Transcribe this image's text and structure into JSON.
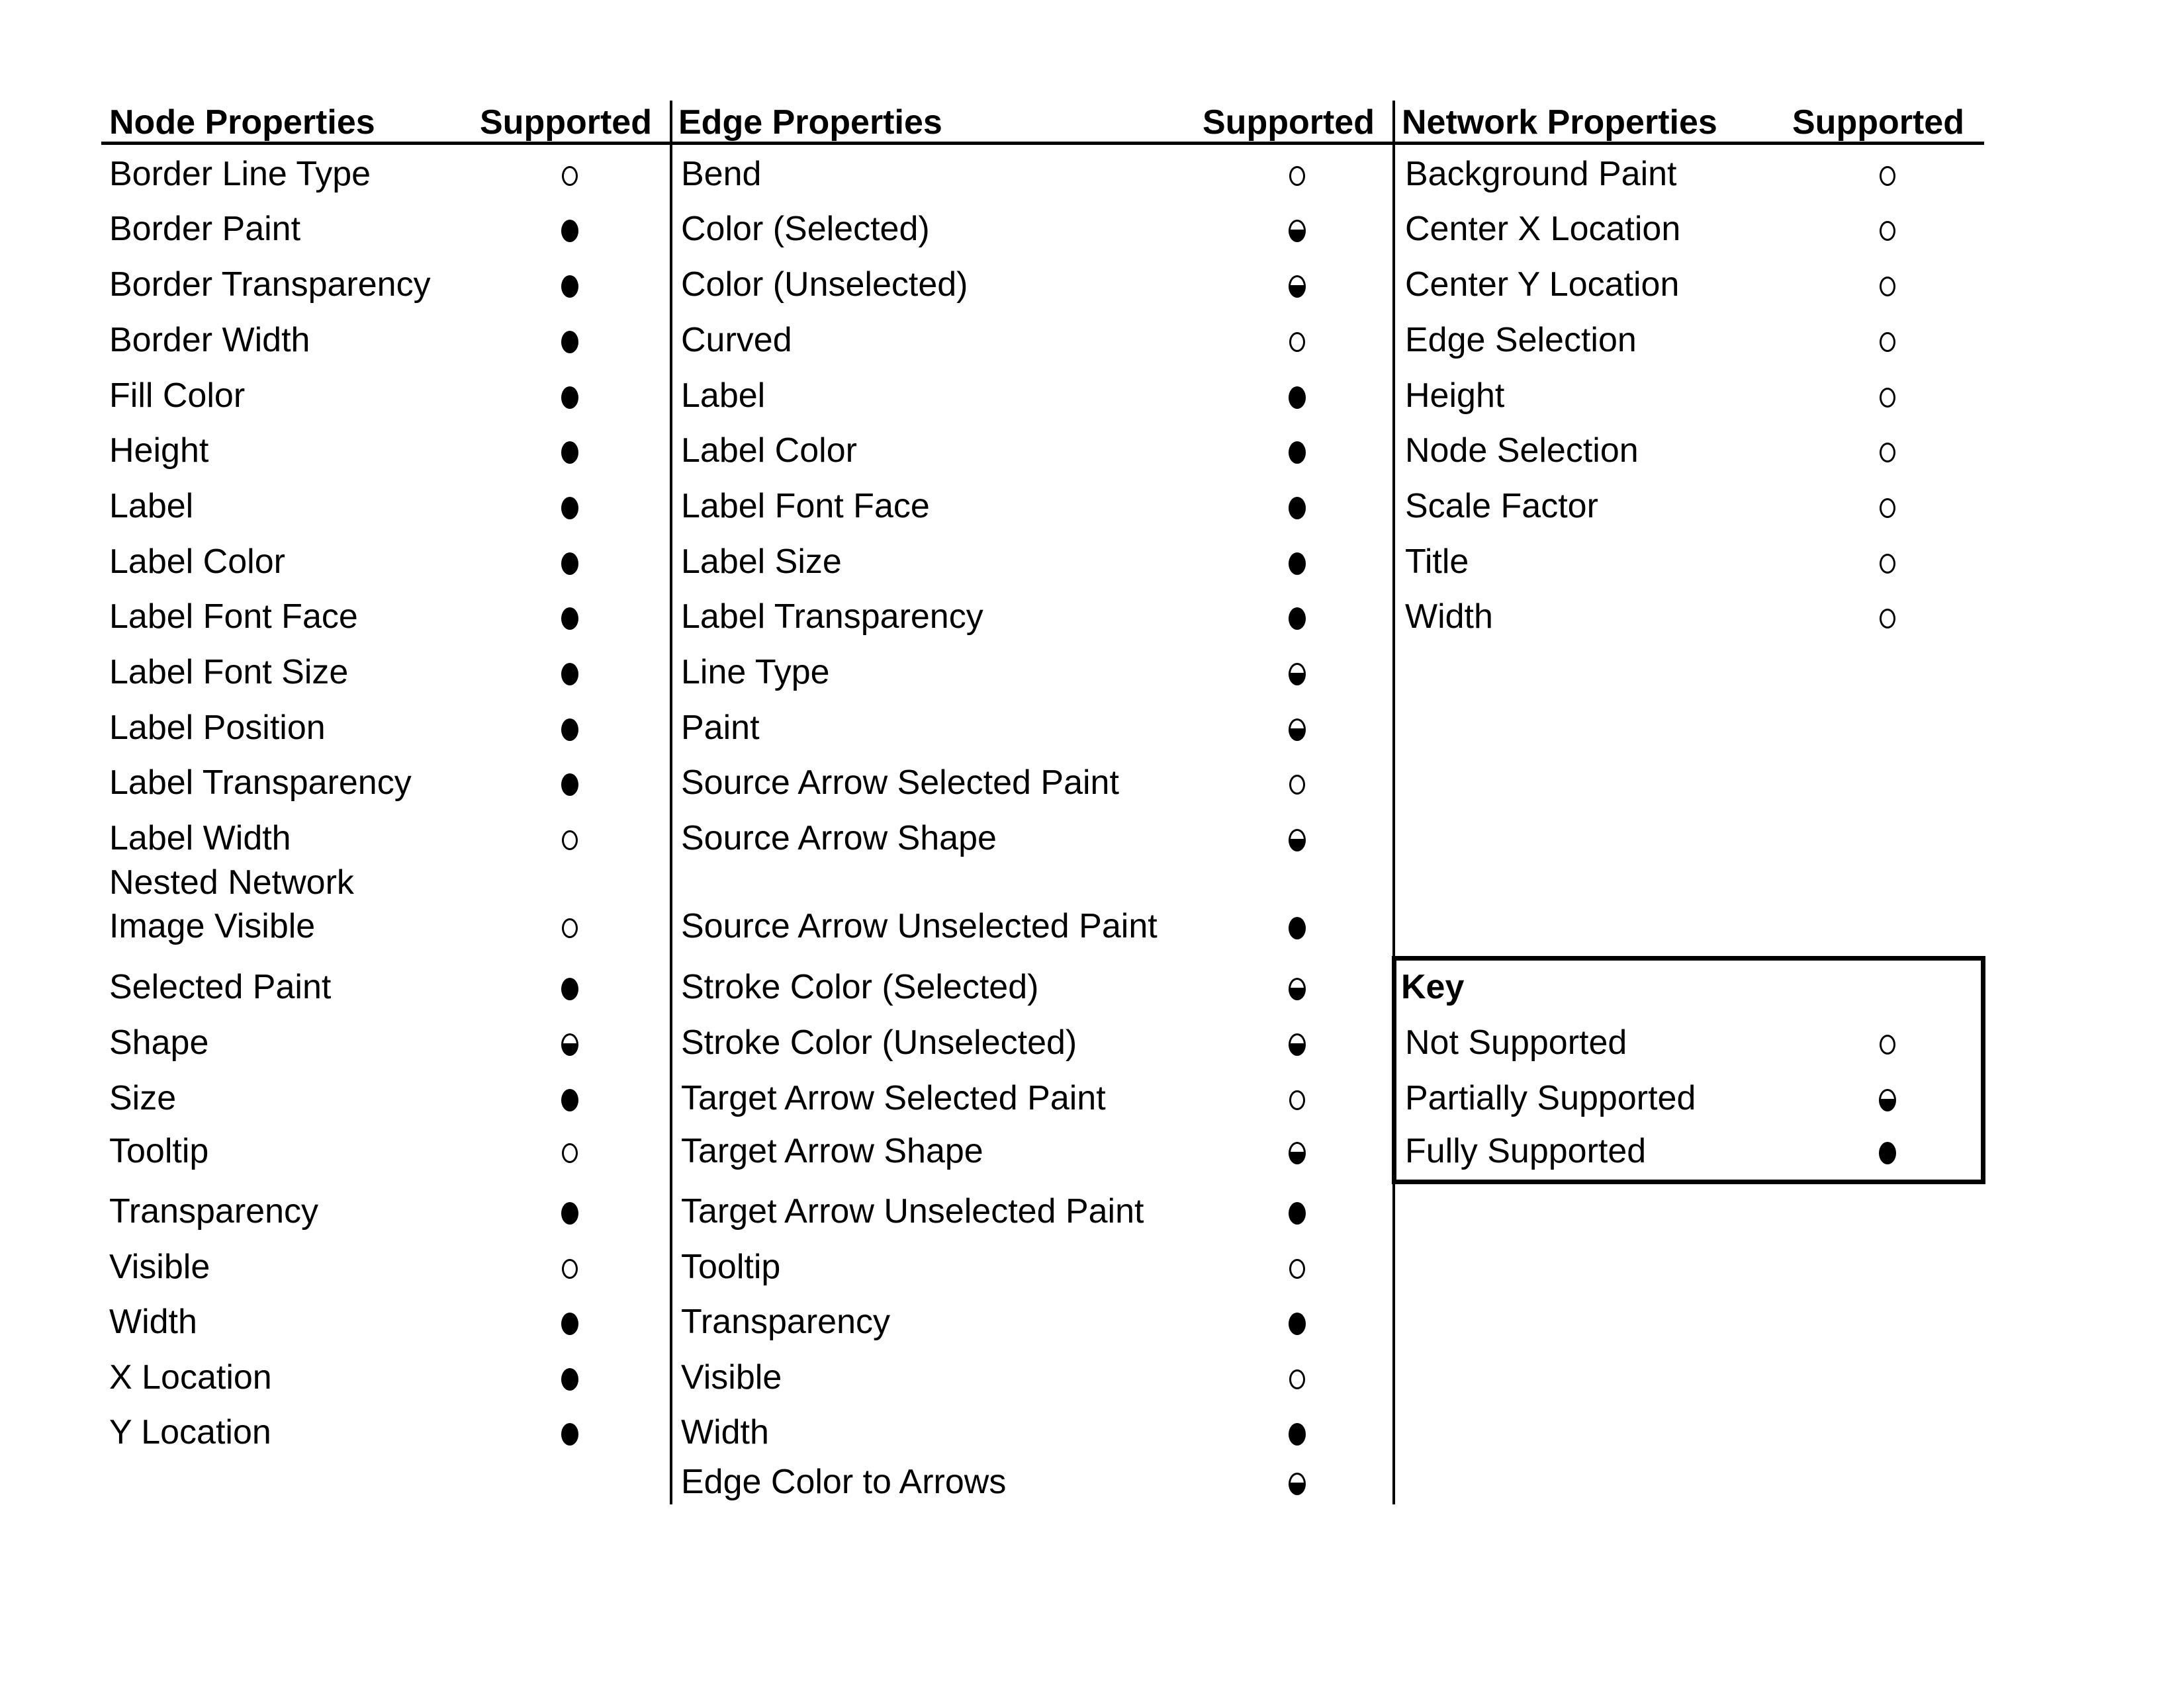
{
  "headers": {
    "node": "Node Properties",
    "edge": "Edge Properties",
    "network": "Network Properties",
    "supported": "Supported"
  },
  "node_properties": [
    {
      "label": "Border Line Type",
      "support": "none"
    },
    {
      "label": "Border Paint",
      "support": "full"
    },
    {
      "label": "Border Transparency",
      "support": "full"
    },
    {
      "label": "Border Width",
      "support": "full"
    },
    {
      "label": "Fill Color",
      "support": "full"
    },
    {
      "label": "Height",
      "support": "full"
    },
    {
      "label": "Label",
      "support": "full"
    },
    {
      "label": "Label Color",
      "support": "full"
    },
    {
      "label": "Label Font Face",
      "support": "full"
    },
    {
      "label": "Label Font Size",
      "support": "full"
    },
    {
      "label": "Label Position",
      "support": "full"
    },
    {
      "label": "Label Transparency",
      "support": "full"
    },
    {
      "label": "Label Width",
      "support": "none"
    },
    {
      "label": "Nested Network",
      "support": ""
    },
    {
      "label": "Image Visible",
      "support": "none"
    },
    {
      "label": "Selected Paint",
      "support": "full"
    },
    {
      "label": "Shape",
      "support": "partial"
    },
    {
      "label": "Size",
      "support": "full"
    },
    {
      "label": "Tooltip",
      "support": "none"
    },
    {
      "label": "Transparency",
      "support": "full"
    },
    {
      "label": "Visible",
      "support": "none"
    },
    {
      "label": "Width",
      "support": "full"
    },
    {
      "label": "X Location",
      "support": "full"
    },
    {
      "label": "Y Location",
      "support": "full"
    }
  ],
  "edge_properties": [
    {
      "label": "Bend",
      "support": "none"
    },
    {
      "label": "Color (Selected)",
      "support": "partial"
    },
    {
      "label": "Color (Unselected)",
      "support": "partial"
    },
    {
      "label": "Curved",
      "support": "none"
    },
    {
      "label": "Label",
      "support": "full"
    },
    {
      "label": "Label Color",
      "support": "full"
    },
    {
      "label": "Label Font Face",
      "support": "full"
    },
    {
      "label": "Label Size",
      "support": "full"
    },
    {
      "label": "Label Transparency",
      "support": "full"
    },
    {
      "label": "Line Type",
      "support": "partial"
    },
    {
      "label": "Paint",
      "support": "partial"
    },
    {
      "label": "Source Arrow Selected Paint",
      "support": "none"
    },
    {
      "label": "Source Arrow Shape",
      "support": "partial"
    },
    {
      "label": "Source Arrow Unselected Paint",
      "support": "full"
    },
    {
      "label": "Stroke Color (Selected)",
      "support": "partial"
    },
    {
      "label": "Stroke Color (Unselected)",
      "support": "partial"
    },
    {
      "label": "Target Arrow Selected Paint",
      "support": "none"
    },
    {
      "label": "Target Arrow Shape",
      "support": "partial"
    },
    {
      "label": "Target Arrow Unselected Paint",
      "support": "full"
    },
    {
      "label": "Tooltip",
      "support": "none"
    },
    {
      "label": "Transparency",
      "support": "full"
    },
    {
      "label": "Visible",
      "support": "none"
    },
    {
      "label": "Width",
      "support": "full"
    },
    {
      "label": "Edge Color to Arrows",
      "support": "partial"
    }
  ],
  "network_properties": [
    {
      "label": "Background Paint",
      "support": "none"
    },
    {
      "label": "Center X Location",
      "support": "none"
    },
    {
      "label": "Center Y Location",
      "support": "none"
    },
    {
      "label": "Edge Selection",
      "support": "none"
    },
    {
      "label": "Height",
      "support": "none"
    },
    {
      "label": "Node Selection",
      "support": "none"
    },
    {
      "label": "Scale Factor",
      "support": "none"
    },
    {
      "label": "Title",
      "support": "none"
    },
    {
      "label": "Width",
      "support": "none"
    }
  ],
  "key": {
    "title": "Key",
    "items": [
      {
        "label": "Not Supported",
        "support": "none"
      },
      {
        "label": "Partially Supported",
        "support": "partial"
      },
      {
        "label": "Fully Supported",
        "support": "full"
      }
    ]
  }
}
